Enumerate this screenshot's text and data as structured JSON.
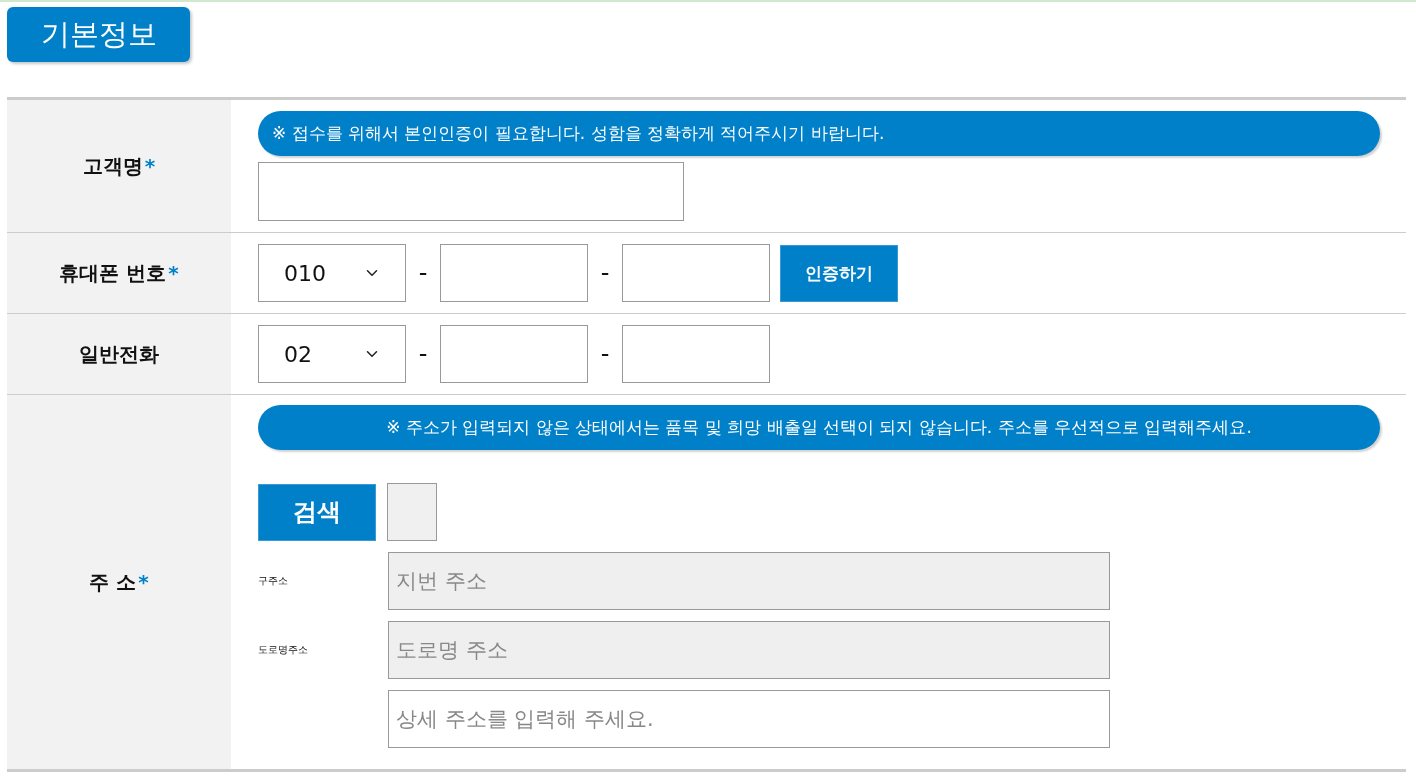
{
  "section_tab": {
    "label": "기본정보"
  },
  "rows": [
    {
      "kind": "text",
      "label": "고객명",
      "required_mark": "*",
      "notice": "※ 접수를 위해서 본인인증이 필요합니다. 성함을 정확하게 적어주시기 바랍니다."
    },
    {
      "kind": "phone",
      "label": "휴대폰 번호",
      "required_mark": "*",
      "area_code": "010",
      "separators": [
        "-",
        "-"
      ],
      "action_button": "인증하기"
    },
    {
      "kind": "phone",
      "label": "일반전화",
      "area_code": "02",
      "separators": [
        "-",
        "-"
      ]
    },
    {
      "kind": "address",
      "label": "주 소",
      "required_mark": "*",
      "notice": "※ 주소가 입력되지 않은 상태에서는 품목 및 희망 배출일 선택이 되지 않습니다. 주소를 우선적으로 입력해주세요.",
      "search_button": "검색",
      "small_field": {
        "readonly": true
      },
      "lines": [
        {
          "label": "구주소",
          "placeholder": "지번 주소",
          "readonly": true
        },
        {
          "label": "도로명주소",
          "placeholder": "도로명 주소",
          "readonly": true
        },
        {
          "placeholder": "상세 주소를 입력해 주세요.",
          "readonly": false
        }
      ]
    }
  ]
}
